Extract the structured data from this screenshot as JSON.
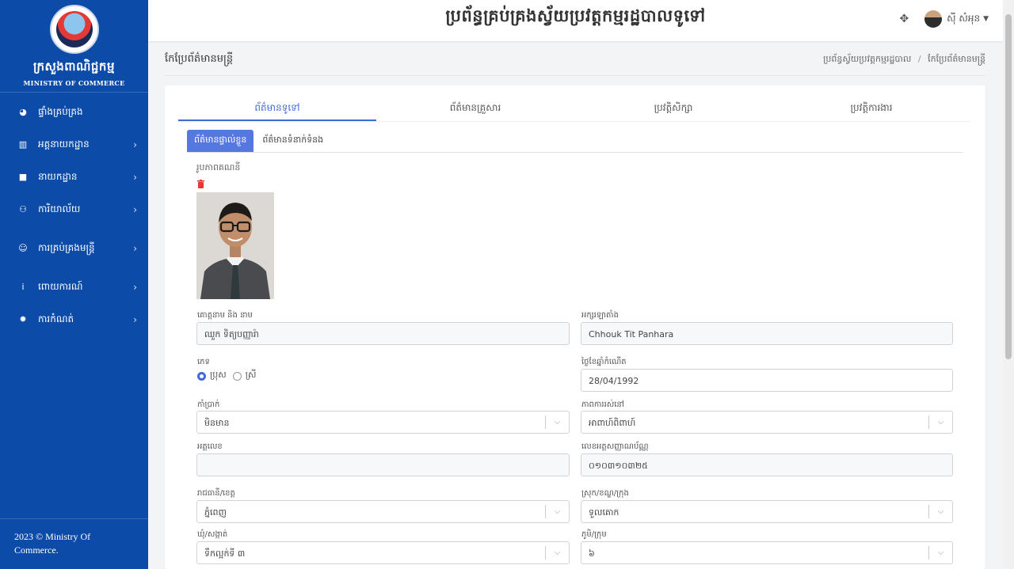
{
  "sidebar": {
    "logo_title": "ក្រសួងពាណិជ្ជកម្ម",
    "logo_subtitle": "MINISTRY OF COMMERCE",
    "items": [
      {
        "label": "ផ្ទាំងគ្រប់គ្រង",
        "icon": "globe-icon"
      },
      {
        "label": "អគ្គនាយកដ្ឋាន",
        "icon": "bank-icon"
      },
      {
        "label": "នាយកដ្ឋាន",
        "icon": "building-icon"
      },
      {
        "label": "ការិយាល័យ",
        "icon": "org-chart-icon"
      },
      {
        "label": "ការគ្រប់គ្រងមន្ត្រី",
        "icon": "users-icon"
      },
      {
        "label": "ពោយការណ៍",
        "icon": "info-icon"
      },
      {
        "label": "ការកំណត់",
        "icon": "gear-icon"
      }
    ],
    "footer": "2023 © Ministry Of Commerce."
  },
  "topbar": {
    "title": "ប្រព័ន្ធគ្រប់គ្រងស្វ័យប្រវត្តកម្មរដ្ឋបាលទូទៅ",
    "user_name": "ស៊ី សំអុន"
  },
  "header": {
    "page_title": "កែប្រែព័ត៌មានមន្ត្រី",
    "breadcrumb": [
      "ប្រព័ន្ធស្វ័យប្រវត្តកម្មរដ្ឋបាល",
      "កែប្រែព័ត៌មានមន្ត្រី"
    ]
  },
  "tabs": [
    "ព័ត៌មានទូទៅ",
    "ព័ត៌មានគ្រួសារ",
    "ប្រវត្តិសិក្សា",
    "ប្រវត្តិការងារ"
  ],
  "subtabs": [
    "ព័ត៌មានផ្ទាល់ខ្លួន",
    "ព័ត៌មានទំនាក់ទំនង"
  ],
  "form": {
    "photo_label": "រូបភាពគណនី",
    "name_kh_label": "គោត្តនាម និង នាម",
    "name_kh_value": "ឈួក ទិត្យបញ្ញារ៉ា",
    "name_latin_label": "អក្សរឡាតាំង",
    "name_latin_value": "Chhouk Tit Panhara",
    "gender_label": "ភេទ",
    "gender_male": "ប្រុស",
    "gender_female": "ស្រី",
    "dob_label": "ថ្ងៃខែឆ្នាំកំណើត",
    "dob_value": "28/04/1992",
    "rank_label": "កាំប្រាក់",
    "rank_value": "មិនមាន",
    "marital_label": "ភាពការរស់នៅ",
    "marital_value": "អាពាហ៍ពិពាហ៍",
    "id_label": "អត្តលេខ",
    "id_value": "",
    "idcard_label": "លេខអត្តសញ្ញាណប័ណ្ណ",
    "idcard_value": "០១០៣១០៣២៥",
    "province_label": "រាជធានី/ខេត្ត",
    "province_value": "ភ្នំពេញ",
    "district_label": "ស្រុក/ខណ្ឌ/ក្រុង",
    "district_value": "ទួលគោក",
    "commune_label": "ឃុំ/សង្កាត់",
    "commune_value": "ទឹកល្អក់ទី ៣",
    "village_label": "ភូមិ/ក្រុម",
    "village_value": "៦"
  }
}
